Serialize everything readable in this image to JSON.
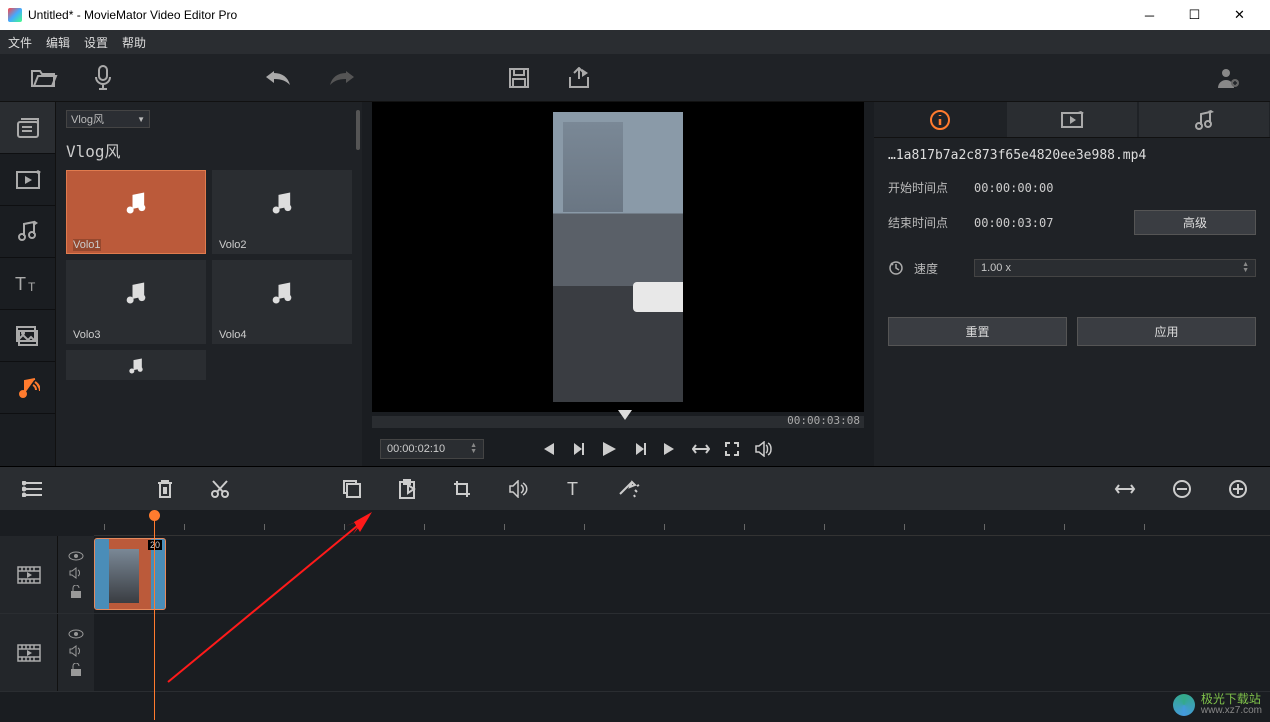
{
  "window": {
    "title": "Untitled* - MovieMator Video Editor Pro"
  },
  "menu": {
    "file": "文件",
    "edit": "编辑",
    "settings": "设置",
    "help": "帮助"
  },
  "mediaBrowser": {
    "categorySelect": "Vlog风",
    "categoryTitle": "Vlog风",
    "items": [
      {
        "label": "Volo1",
        "selected": true
      },
      {
        "label": "Volo2"
      },
      {
        "label": "Volo3"
      },
      {
        "label": "Volo4"
      }
    ]
  },
  "preview": {
    "scrubTime": "00:00:03:08",
    "timecode": "00:00:02:10"
  },
  "properties": {
    "filename": "…1a817b7a2c873f65e4820ee3e988.mp4",
    "startLabel": "开始时间点",
    "startValue": "00:00:00:00",
    "endLabel": "结束时间点",
    "endValue": "00:00:03:07",
    "advancedBtn": "高级",
    "speedLabel": "速度",
    "speedValue": "1.00 x",
    "resetBtn": "重置",
    "applyBtn": "应用"
  },
  "timeline": {
    "clipNum": "20"
  },
  "watermark": {
    "cn": "极光下载站",
    "url": "www.xz7.com"
  }
}
